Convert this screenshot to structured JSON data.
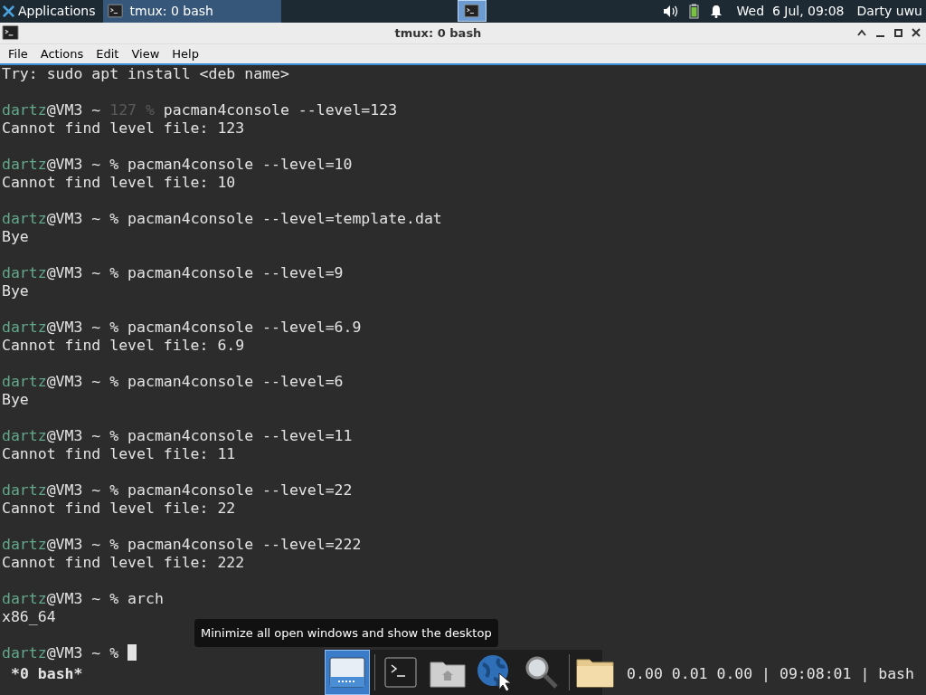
{
  "top_panel": {
    "apps_menu": "Applications",
    "tasks": [
      {
        "label": "tmux: 0 bash",
        "selected": true
      }
    ],
    "workspaces": [
      {
        "selected": true
      }
    ],
    "clock": "Wed  6 Jul, 09:08",
    "user": "Darty uwu"
  },
  "window": {
    "title": "tmux: 0 bash"
  },
  "menu": [
    "File",
    "Actions",
    "Edit",
    "View",
    "Help"
  ],
  "terminal": {
    "lines": [
      {
        "kind": "output",
        "text": "Try: sudo apt install <deb name>"
      },
      {
        "kind": "prompt",
        "user": "dartz",
        "host": "@VM3 ~ ",
        "status": "127 %",
        "command": "pacman4console --level=123"
      },
      {
        "kind": "output",
        "text": "Cannot find level file: 123"
      },
      {
        "kind": "prompt",
        "user": "dartz",
        "host": "@VM3 ~ ",
        "symbol": "%",
        "command": "pacman4console --level=10"
      },
      {
        "kind": "output",
        "text": "Cannot find level file: 10"
      },
      {
        "kind": "prompt",
        "user": "dartz",
        "host": "@VM3 ~ ",
        "symbol": "%",
        "command": "pacman4console --level=template.dat"
      },
      {
        "kind": "output",
        "text": "Bye"
      },
      {
        "kind": "prompt",
        "user": "dartz",
        "host": "@VM3 ~ ",
        "symbol": "%",
        "command": "pacman4console --level=9"
      },
      {
        "kind": "output",
        "text": "Bye"
      },
      {
        "kind": "prompt",
        "user": "dartz",
        "host": "@VM3 ~ ",
        "symbol": "%",
        "command": "pacman4console --level=6.9"
      },
      {
        "kind": "output",
        "text": "Cannot find level file: 6.9"
      },
      {
        "kind": "prompt",
        "user": "dartz",
        "host": "@VM3 ~ ",
        "symbol": "%",
        "command": "pacman4console --level=6"
      },
      {
        "kind": "output",
        "text": "Bye"
      },
      {
        "kind": "prompt",
        "user": "dartz",
        "host": "@VM3 ~ ",
        "symbol": "%",
        "command": "pacman4console --level=11"
      },
      {
        "kind": "output",
        "text": "Cannot find level file: 11"
      },
      {
        "kind": "prompt",
        "user": "dartz",
        "host": "@VM3 ~ ",
        "symbol": "%",
        "command": "pacman4console --level=22"
      },
      {
        "kind": "output",
        "text": "Cannot find level file: 22"
      },
      {
        "kind": "prompt",
        "user": "dartz",
        "host": "@VM3 ~ ",
        "symbol": "%",
        "command": "pacman4console --level=222"
      },
      {
        "kind": "output",
        "text": "Cannot find level file: 222"
      },
      {
        "kind": "prompt",
        "user": "dartz",
        "host": "@VM3 ~ ",
        "symbol": "%",
        "command": "arch"
      },
      {
        "kind": "output",
        "text": "x86_64"
      },
      {
        "kind": "prompt",
        "user": "dartz",
        "host": "@VM3 ~ ",
        "symbol": "%",
        "cursor": true
      }
    ],
    "status_left": "*0 bash*",
    "status_right": "0.00 0.01 0.00 | 09:08:01 | bash"
  },
  "dock": {
    "items": [
      {
        "kind": "desktop",
        "selected": true
      },
      {
        "kind": "terminal",
        "selected": false
      },
      {
        "kind": "home",
        "selected": false
      },
      {
        "kind": "web",
        "selected": false
      },
      {
        "kind": "search",
        "selected": false
      },
      {
        "kind": "folder",
        "selected": false
      }
    ],
    "tooltip": "Minimize all open windows and show the desktop"
  }
}
